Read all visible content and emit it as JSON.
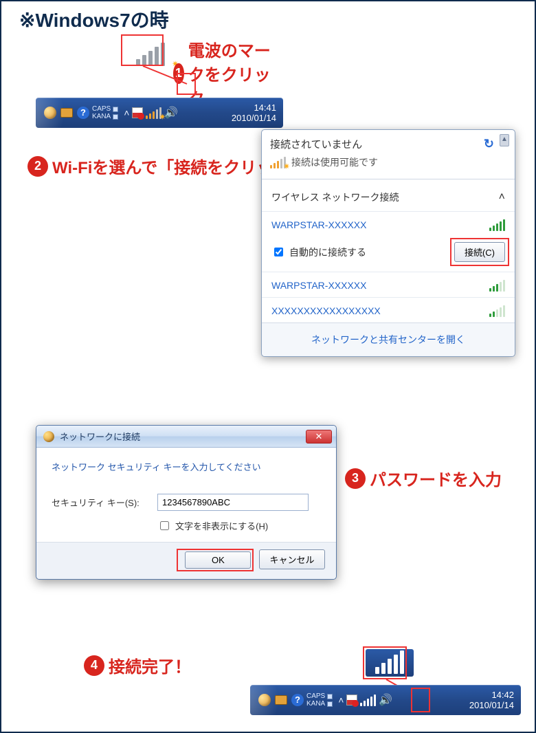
{
  "title": "※Windows7の時",
  "callouts": {
    "c1": "電波のマークをクリック",
    "c2": "Wi-Fiを選んで「接続をクリック」",
    "c3": "パスワードを入力",
    "c4": "接続完了！"
  },
  "taskbar1": {
    "caps": "CAPS",
    "kana": "KANA",
    "time": "14:41",
    "date": "2010/01/14"
  },
  "taskbar2": {
    "caps": "CAPS",
    "kana": "KANA",
    "time": "14:42",
    "date": "2010/01/14"
  },
  "flyout": {
    "not_connected": "接続されていません",
    "available": "接続は使用可能です",
    "section_label": "ワイヤレス ネットワーク接続",
    "networks": [
      "WARPSTAR-XXXXXX",
      "WARPSTAR-XXXXXX",
      "XXXXXXXXXXXXXXXXX"
    ],
    "auto_connect": "自動的に接続する",
    "connect_btn": "接続(C)",
    "footer_link": "ネットワークと共有センターを開く"
  },
  "dialog": {
    "title": "ネットワークに接続",
    "prompt": "ネットワーク セキュリティ キーを入力してください",
    "field_label": "セキュリティ キー(S):",
    "field_value": "1234567890ABC",
    "hide_chars": "文字を非表示にする(H)",
    "ok": "OK",
    "cancel": "キャンセル"
  }
}
